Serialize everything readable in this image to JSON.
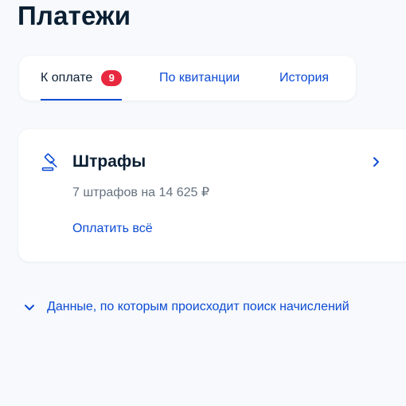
{
  "page": {
    "title": "Платежи"
  },
  "tabs": [
    {
      "label": "К оплате",
      "badge": "9",
      "active": true
    },
    {
      "label": "По квитанции",
      "active": false
    },
    {
      "label": "История",
      "active": false
    }
  ],
  "fines_card": {
    "icon": "gavel-icon",
    "title": "Штрафы",
    "subtitle": "7 штрафов на 14 625 ₽",
    "action_label": "Оплатить всё"
  },
  "search_data": {
    "label": "Данные, по которым происходит поиск начислений"
  },
  "colors": {
    "accent": "#0d4cd3",
    "badge": "#e8283f",
    "text_primary": "#0b1f33",
    "text_secondary": "#66727f",
    "background": "#f7f9fc",
    "card": "#ffffff"
  }
}
